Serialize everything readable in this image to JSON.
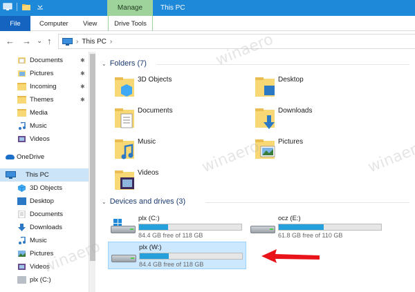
{
  "titlebar": {
    "manage_label": "Manage",
    "title": "This PC"
  },
  "ribbon": {
    "file": "File",
    "computer": "Computer",
    "view": "View",
    "drive_tools": "Drive Tools"
  },
  "address": {
    "path": "This PC",
    "separator": "›"
  },
  "nav_buttons": {
    "back": "←",
    "forward": "→",
    "recent": "⌄",
    "up": "↑"
  },
  "navpane": {
    "quick_access": [
      {
        "label": "Documents",
        "icon": "documents-icon",
        "pinned": true
      },
      {
        "label": "Pictures",
        "icon": "pictures-icon",
        "pinned": true
      },
      {
        "label": "Incoming",
        "icon": "folder-icon",
        "pinned": true
      },
      {
        "label": "Themes",
        "icon": "folder-icon",
        "pinned": true
      },
      {
        "label": "Media",
        "icon": "folder-icon",
        "pinned": false
      },
      {
        "label": "Music",
        "icon": "music-icon",
        "pinned": false
      },
      {
        "label": "Videos",
        "icon": "videos-icon",
        "pinned": false
      }
    ],
    "onedrive": "OneDrive",
    "this_pc": "This PC",
    "this_pc_children": [
      {
        "label": "3D Objects",
        "icon": "3d-objects-icon"
      },
      {
        "label": "Desktop",
        "icon": "desktop-icon"
      },
      {
        "label": "Documents",
        "icon": "documents-icon"
      },
      {
        "label": "Downloads",
        "icon": "downloads-icon"
      },
      {
        "label": "Music",
        "icon": "music-icon"
      },
      {
        "label": "Pictures",
        "icon": "pictures-icon"
      },
      {
        "label": "Videos",
        "icon": "videos-icon"
      },
      {
        "label": "plx (C:)",
        "icon": "drive-icon"
      }
    ],
    "pin_glyph": "📌"
  },
  "content": {
    "folders_header": "Folders (7)",
    "folders": [
      {
        "label": "3D Objects",
        "icon": "3d-objects-icon"
      },
      {
        "label": "Desktop",
        "icon": "desktop-icon"
      },
      {
        "label": "Documents",
        "icon": "documents-icon"
      },
      {
        "label": "Downloads",
        "icon": "downloads-icon"
      },
      {
        "label": "Music",
        "icon": "music-icon"
      },
      {
        "label": "Pictures",
        "icon": "pictures-icon"
      },
      {
        "label": "Videos",
        "icon": "videos-icon"
      }
    ],
    "drives_header": "Devices and drives (3)",
    "drives": [
      {
        "label": "plx (C:)",
        "free_text": "84.4 GB free of 118 GB",
        "used_fraction": 0.285,
        "system": true
      },
      {
        "label": "ocz (E:)",
        "free_text": "61.8 GB free of 110 GB",
        "used_fraction": 0.44,
        "system": false
      },
      {
        "label": "plx (W:)",
        "free_text": "84.4 GB free of 118 GB",
        "used_fraction": 0.285,
        "system": false,
        "selected": true
      }
    ]
  },
  "colors": {
    "accent": "#1e88d9",
    "manage_tab": "#9ed39b",
    "selection": "#cce8ff",
    "bar_fill": "#26a0da",
    "annotation_arrow": "#e8141a"
  },
  "watermark": "winaero.com"
}
